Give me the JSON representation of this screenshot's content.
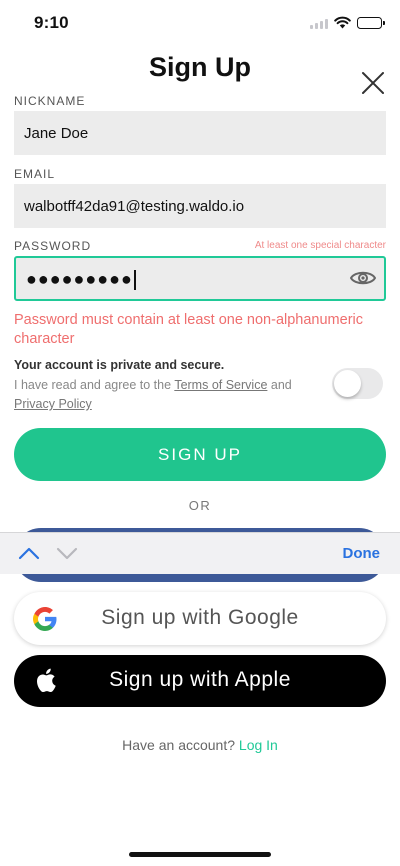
{
  "status_bar": {
    "time": "9:10"
  },
  "header": {
    "title": "Sign Up"
  },
  "form": {
    "nickname_label": "NICKNAME",
    "nickname_value": "Jane Doe",
    "email_label": "EMAIL",
    "email_value": "walbotff42da91@testing.waldo.io",
    "password_label": "PASSWORD",
    "password_hint": "At least one special character",
    "password_masked": "●●●●●●●●●",
    "password_error": "Password must contain at least one non-alphanumeric character"
  },
  "privacy": {
    "heading": "Your account is private and secure.",
    "text_before": "I have read and agree to the ",
    "terms_link": "Terms of Service",
    "text_middle": " and ",
    "privacy_link": "Privacy Policy",
    "agreed": false
  },
  "actions": {
    "signup_label": "SIGN UP",
    "or_label": "OR",
    "google_label": "Sign up with Google",
    "apple_label": "Sign up with Apple"
  },
  "keyboard_bar": {
    "done_label": "Done"
  },
  "footer": {
    "have_account": "Have an account?",
    "login_label": "Log In"
  },
  "colors": {
    "accent": "#20c58e",
    "error": "#ef6e6e",
    "facebook": "#3d5998",
    "link_blue": "#2a72e0"
  }
}
